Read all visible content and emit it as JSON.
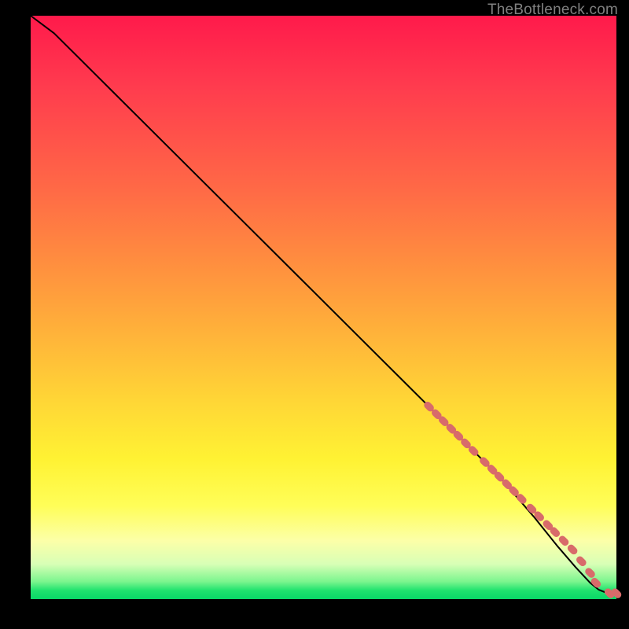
{
  "attribution": "TheBottleneck.com",
  "colors": {
    "page_bg": "#000000",
    "gradient_top": "#ff1a4b",
    "gradient_bottom": "#09d867",
    "curve": "#000000",
    "marker": "#d86b6a"
  },
  "chart_data": {
    "type": "line",
    "title": "",
    "xlabel": "",
    "ylabel": "",
    "xlim": [
      0,
      100
    ],
    "ylim": [
      0,
      100
    ],
    "grid": false,
    "series": [
      {
        "name": "curve",
        "x": [
          0,
          4,
          8,
          14,
          24,
          36,
          48,
          60,
          72,
          80,
          86,
          90,
          93,
          95.5,
          97,
          98.5,
          100
        ],
        "y": [
          100,
          97,
          93,
          87,
          77,
          65,
          53,
          41,
          29,
          21,
          14,
          9,
          5.5,
          2.8,
          1.6,
          1.0,
          1.0
        ]
      }
    ],
    "markers": [
      {
        "x": 68.0,
        "y": 33.0
      },
      {
        "x": 69.3,
        "y": 31.7
      },
      {
        "x": 70.5,
        "y": 30.5
      },
      {
        "x": 71.8,
        "y": 29.2
      },
      {
        "x": 73.0,
        "y": 28.0
      },
      {
        "x": 74.3,
        "y": 26.7
      },
      {
        "x": 75.6,
        "y": 25.4
      },
      {
        "x": 77.5,
        "y": 23.5
      },
      {
        "x": 78.8,
        "y": 22.2
      },
      {
        "x": 80.0,
        "y": 21.0
      },
      {
        "x": 81.3,
        "y": 19.7
      },
      {
        "x": 82.5,
        "y": 18.5
      },
      {
        "x": 83.8,
        "y": 17.2
      },
      {
        "x": 85.5,
        "y": 15.5
      },
      {
        "x": 86.8,
        "y": 14.2
      },
      {
        "x": 88.3,
        "y": 12.7
      },
      {
        "x": 89.5,
        "y": 11.5
      },
      {
        "x": 91.0,
        "y": 10.0
      },
      {
        "x": 92.5,
        "y": 8.5
      },
      {
        "x": 94.0,
        "y": 6.5
      },
      {
        "x": 95.5,
        "y": 4.5
      },
      {
        "x": 96.5,
        "y": 2.8
      },
      {
        "x": 98.8,
        "y": 1.0
      },
      {
        "x": 100.0,
        "y": 1.0
      }
    ]
  }
}
